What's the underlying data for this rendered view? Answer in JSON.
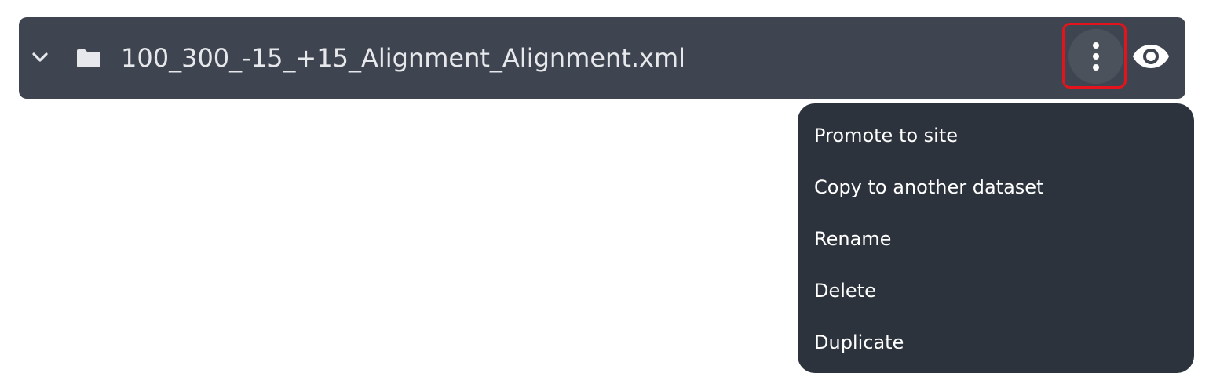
{
  "file_row": {
    "name": "100_300_-15_+15_Alignment_Alignment.xml",
    "expand_icon": "chevron-down-icon",
    "folder_icon": "folder-icon",
    "more_icon": "more-vertical-icon",
    "visibility_icon": "eye-icon"
  },
  "context_menu": {
    "items": [
      {
        "label": "Promote to site"
      },
      {
        "label": "Copy to another dataset"
      },
      {
        "label": "Rename"
      },
      {
        "label": "Delete"
      },
      {
        "label": "Duplicate"
      }
    ]
  },
  "colors": {
    "row_background": "#3f4550",
    "menu_background": "#2d333c",
    "highlight_border": "#e3141b",
    "text": "#e6e8eb"
  }
}
